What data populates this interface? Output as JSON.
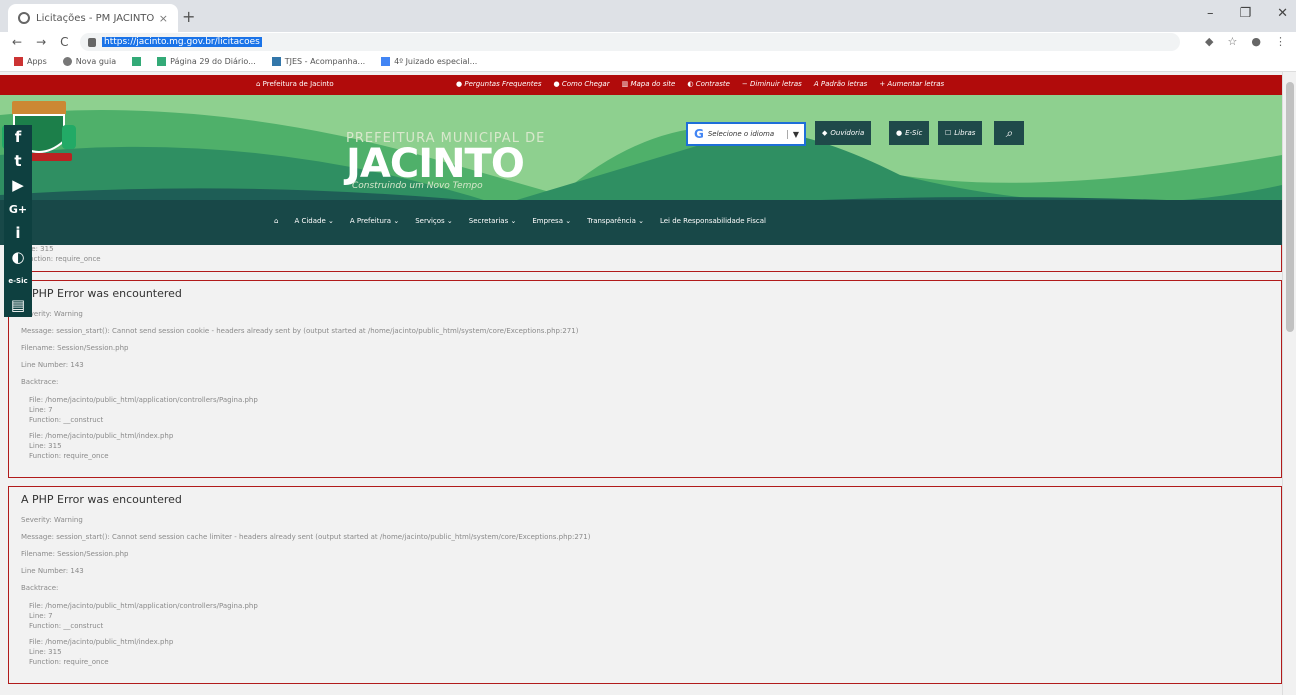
{
  "browser": {
    "tab_title": "Licitações - PM JACINTO",
    "tab_close": "×",
    "new_tab": "+",
    "win_min": "–",
    "win_max": "❐",
    "win_close": "✕",
    "url": "https://jacinto.mg.gov.br/licitacoes",
    "bookmarks": [
      "Apps",
      "Nova guia",
      "",
      "Página 29 do Diário...",
      "TJES - Acompanha...",
      "4º Juizado especial..."
    ]
  },
  "topbar": {
    "prefeitura": "Prefeitura de Jacinto",
    "links": [
      "Perguntas Frequentes",
      "Como Chegar",
      "Mapa do site",
      "Contraste",
      "Diminuir letras",
      "Padrão letras",
      "Aumentar letras"
    ]
  },
  "header": {
    "name_upper": "PREFEITURA MUNICIPAL DE",
    "name": "JACINTO",
    "slogan": "Construindo um Novo Tempo",
    "lang_label": "Selecione o idioma",
    "btn_ouvidoria": "Ouvidoria",
    "btn_esic": "E-Sic",
    "btn_libras": "Libras"
  },
  "menu": {
    "items": [
      "A Cidade",
      "A Prefeitura",
      "Serviços",
      "Secretarias",
      "Empresa",
      "Transparência",
      "Lei de Responsabilidade Fiscal"
    ]
  },
  "social": [
    "f",
    "t",
    "▶",
    "G+",
    "i",
    "◐",
    "e-Sic",
    "▤"
  ],
  "partial_error": {
    "line": "Line: 315",
    "func": "Function: require_once"
  },
  "errors": [
    {
      "title": "A PHP Error was encountered",
      "severity": "Severity: Warning",
      "message": "Message: session_start(): Cannot send session cookie - headers already sent by (output started at /home/jacinto/public_html/system/core/Exceptions.php:271)",
      "filename": "Filename: Session/Session.php",
      "line": "Line Number: 143",
      "backtrace": "Backtrace:",
      "t1_file": "File: /home/jacinto/public_html/application/controllers/Pagina.php",
      "t1_line": "Line: 7",
      "t1_func": "Function: __construct",
      "t2_file": "File: /home/jacinto/public_html/index.php",
      "t2_line": "Line: 315",
      "t2_func": "Function: require_once"
    },
    {
      "title": "A PHP Error was encountered",
      "severity": "Severity: Warning",
      "message": "Message: session_start(): Cannot send session cache limiter - headers already sent (output started at /home/jacinto/public_html/system/core/Exceptions.php:271)",
      "filename": "Filename: Session/Session.php",
      "line": "Line Number: 143",
      "backtrace": "Backtrace:",
      "t1_file": "File: /home/jacinto/public_html/application/controllers/Pagina.php",
      "t1_line": "Line: 7",
      "t1_func": "Function: __construct",
      "t2_file": "File: /home/jacinto/public_html/index.php",
      "t2_line": "Line: 315",
      "t2_func": "Function: require_once"
    }
  ]
}
